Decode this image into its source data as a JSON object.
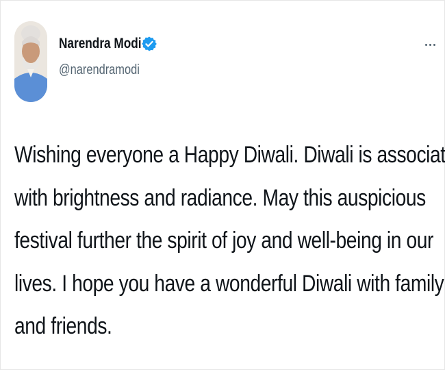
{
  "tweet": {
    "author": {
      "display_name": "Narendra Modi",
      "handle": "@narendramodi",
      "verified_icon": "verified-badge-icon",
      "avatar_icon": "profile-photo"
    },
    "more_icon": "more-options-icon",
    "text_lines": [
      "Wishing everyone a Happy Diwali. Diwali is associated",
      "with brightness and radiance. May this auspicious",
      "festival further the spirit of joy and well-being in our",
      "lives. I hope you have a wonderful Diwali with family",
      "and friends."
    ]
  },
  "colors": {
    "text": "#0f1419",
    "secondary_text": "#536471",
    "verified_blue": "#1d9bf0",
    "background": "#ffffff"
  }
}
